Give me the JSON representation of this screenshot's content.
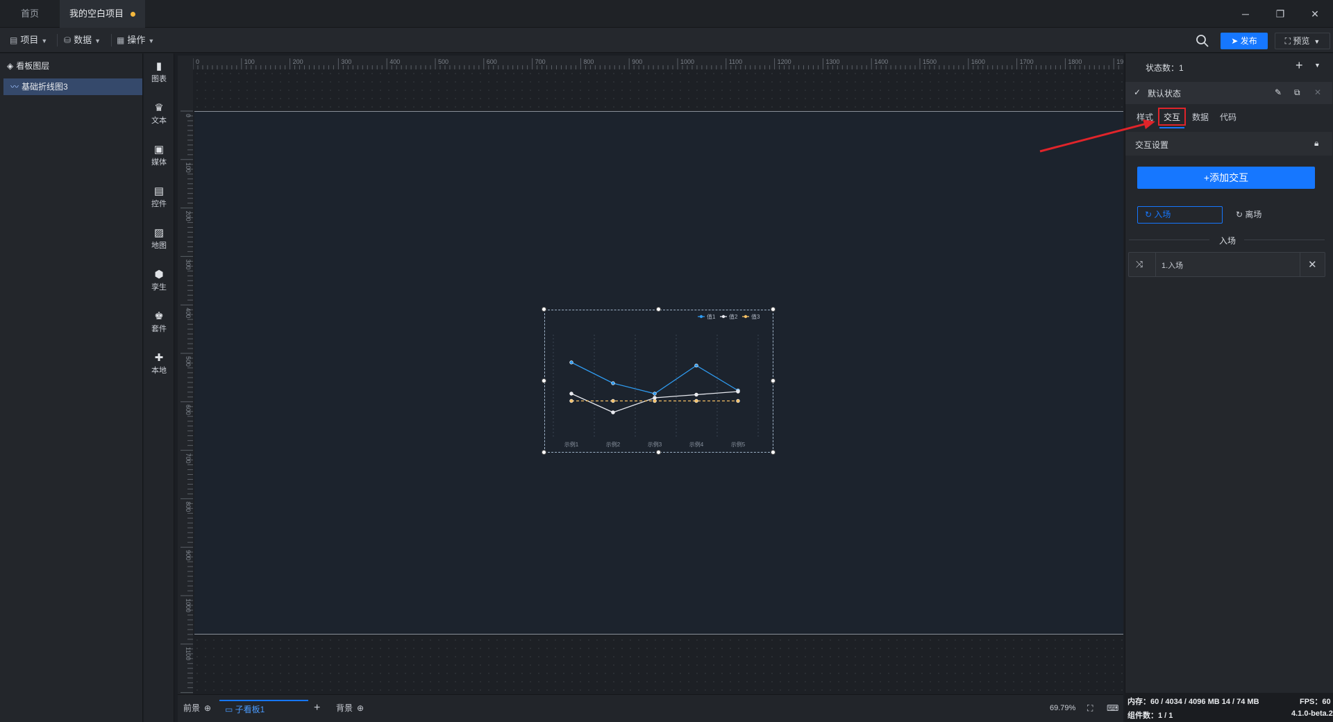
{
  "titlebar": {
    "tabs": [
      {
        "label": "首页"
      },
      {
        "label": "我的空白项目"
      }
    ],
    "minimize": "─",
    "restore": "❐",
    "close": "✕"
  },
  "menubar": {
    "items": [
      {
        "label": "项目",
        "icon": "file-icon"
      },
      {
        "label": "数据",
        "icon": "database-icon"
      },
      {
        "label": "操作",
        "icon": "grid-icon"
      }
    ],
    "publish_label": "发布",
    "preview_label": "预览"
  },
  "layers": {
    "title": "看板图层",
    "items": [
      {
        "label": "基础折线图3"
      }
    ]
  },
  "toolbox": {
    "items": [
      {
        "label": "图表",
        "icon": "bar-chart-icon"
      },
      {
        "label": "文本",
        "icon": "text-icon"
      },
      {
        "label": "媒体",
        "icon": "media-icon"
      },
      {
        "label": "控件",
        "icon": "control-icon"
      },
      {
        "label": "地图",
        "icon": "map-icon"
      },
      {
        "label": "孪生",
        "icon": "cube-icon"
      },
      {
        "label": "套件",
        "icon": "suite-icon"
      },
      {
        "label": "本地",
        "icon": "puzzle-icon"
      }
    ]
  },
  "ruler": {
    "top_ticks": [
      "0",
      "100",
      "200",
      "300",
      "400",
      "500",
      "600",
      "700",
      "800",
      "900",
      "1000",
      "1100",
      "1200",
      "1300",
      "1400",
      "1500",
      "1600",
      "1700",
      "1800",
      "1900"
    ],
    "left_ticks": [
      "0",
      "100",
      "200",
      "300",
      "400",
      "500",
      "600",
      "700",
      "800",
      "900",
      "1000",
      "1100",
      "1200"
    ]
  },
  "chart_data": {
    "type": "line",
    "categories": [
      "示例1",
      "示例2",
      "示例3",
      "示例4",
      "示例5"
    ],
    "series": [
      {
        "name": "值1",
        "values": [
          70,
          50,
          40,
          67,
          43
        ],
        "color": "#2f9bf0",
        "dashed": false
      },
      {
        "name": "值2",
        "values": [
          40,
          22,
          36,
          39,
          42
        ],
        "color": "#e6e8ee",
        "dashed": false
      },
      {
        "name": "值3",
        "values": [
          33,
          33,
          33,
          33,
          33
        ],
        "color": "#f5c064",
        "dashed": true
      }
    ],
    "ylim": [
      0,
      100
    ],
    "legend": "top-right",
    "grid": "vertical-dashed"
  },
  "bottombar": {
    "front_label": "前景",
    "board_label": "子看板1",
    "back_label": "背景",
    "add": "+",
    "zoom": "69.79%"
  },
  "props": {
    "state_count_label": "状态数：1",
    "default_state": "默认状态",
    "tabs": [
      "样式",
      "交互",
      "数据",
      "代码"
    ],
    "section_title": "交互设置",
    "add_button": "+添加交互",
    "enter_tab": "入场",
    "leave_tab": "离场",
    "divider_label": "入场",
    "entry_label": "1.入场"
  },
  "status": {
    "memory": "内存：60 / 4034 / 4096 MB 14 / 74 MB",
    "fps": "FPS：60",
    "components": "组件数：1 / 1",
    "version": "4.1.0-beta.2"
  },
  "colors": {
    "accent": "#1677ff",
    "highlight": "#e0242a"
  }
}
